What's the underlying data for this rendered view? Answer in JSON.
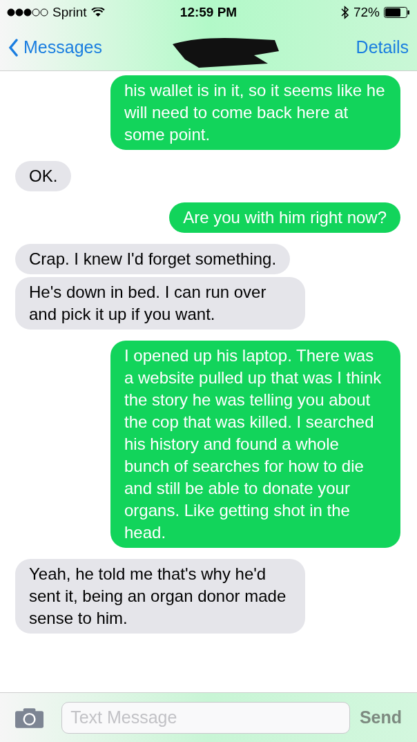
{
  "status_bar": {
    "carrier": "Sprint",
    "time": "12:59 PM",
    "battery": "72%"
  },
  "nav": {
    "back": "Messages",
    "action": "Details"
  },
  "messages": [
    {
      "kind": "sent",
      "text": "his wallet is in it, so it seems like he will need to come back here at some point."
    },
    {
      "kind": "received",
      "text": "OK."
    },
    {
      "kind": "sent",
      "text": "Are you with him right now?"
    },
    {
      "kind": "received",
      "text": "Crap. I knew I'd forget something."
    },
    {
      "kind": "received",
      "text": "He's down in bed. I can run over and pick it up if you want."
    },
    {
      "kind": "sent",
      "text": "I opened up his laptop. There was a website pulled up that was I think the story he was telling you about the cop that was killed. I searched his history and found a whole bunch of searches for how to die and still be able to donate your organs. Like getting shot in the head."
    },
    {
      "kind": "received",
      "text": "Yeah, he told me that's why he'd sent it, being an organ donor made sense to him."
    }
  ],
  "composer": {
    "placeholder": "Text Message",
    "send": "Send"
  }
}
